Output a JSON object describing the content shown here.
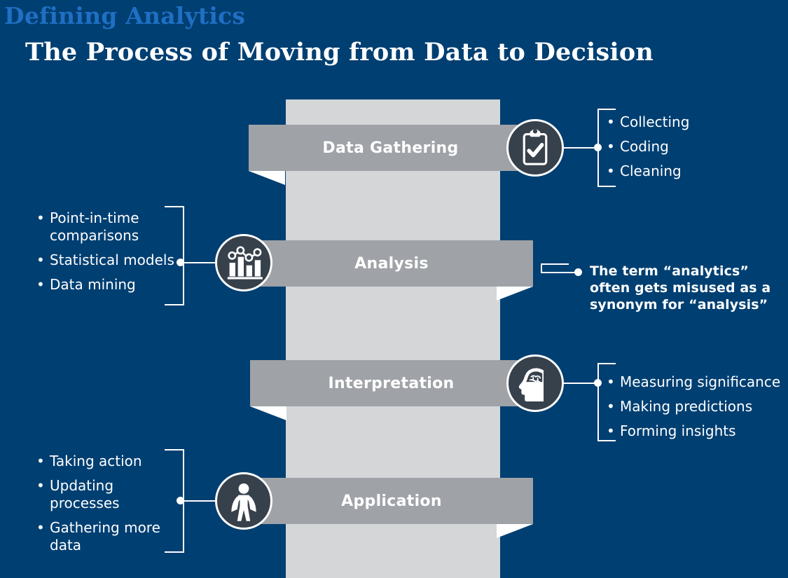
{
  "header": {
    "eyebrow": "Defining Analytics",
    "headline": "The Process of Moving from Data to Decision"
  },
  "colors": {
    "background": "#003f72",
    "eyebrow": "#1f6fc4",
    "column": "#d4d6d8",
    "ribbon": "#9fa2a7",
    "badge": "#37414c",
    "text": "#ffffff"
  },
  "stages": [
    {
      "label": "Data Gathering",
      "icon": "clipboard-check-icon",
      "icon_side": "right",
      "bullets": [
        "Collecting",
        "Coding",
        "Cleaning"
      ]
    },
    {
      "label": "Analysis",
      "icon": "bar-chart-line-icon",
      "icon_side": "left",
      "bullets": [
        "Point-in-time\ncomparisons",
        "Statistical models",
        "Data mining"
      ]
    },
    {
      "label": "Interpretation",
      "icon": "brain-head-icon",
      "icon_side": "right",
      "bullets": [
        "Measuring significance",
        "Making predictions",
        "Forming insights"
      ]
    },
    {
      "label": "Application",
      "icon": "hero-person-icon",
      "icon_side": "left",
      "bullets": [
        "Taking action",
        "Updating\nprocesses",
        "Gathering more\ndata"
      ]
    }
  ],
  "note": {
    "text": "The term “analytics”\noften gets misused as a\nsynonym for “analysis”"
  },
  "bullet_marker": "•"
}
